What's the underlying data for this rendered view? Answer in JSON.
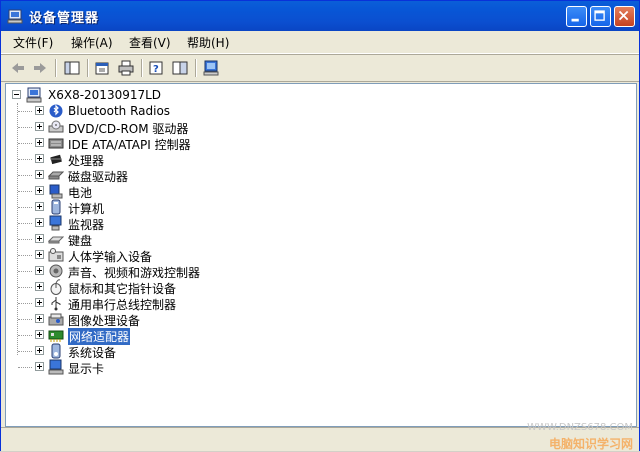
{
  "window": {
    "title": "设备管理器"
  },
  "menu": [
    {
      "label": "文件(F)"
    },
    {
      "label": "操作(A)"
    },
    {
      "label": "查看(V)"
    },
    {
      "label": "帮助(H)"
    }
  ],
  "toolbar": {
    "items": [
      "back-icon",
      "forward-icon",
      "show-tree-icon",
      "properties-icon",
      "print-icon",
      "help-icon",
      "device-view-icon",
      "scan-hardware-icon"
    ]
  },
  "tree": {
    "root": "X6X8-20130917LD",
    "items": [
      {
        "label": "Bluetooth Radios",
        "icon": "bluetooth-icon"
      },
      {
        "label": "DVD/CD-ROM 驱动器",
        "icon": "dvd-drive-icon"
      },
      {
        "label": "IDE ATA/ATAPI 控制器",
        "icon": "ide-controller-icon"
      },
      {
        "label": "处理器",
        "icon": "processor-icon"
      },
      {
        "label": "磁盘驱动器",
        "icon": "disk-drive-icon"
      },
      {
        "label": "电池",
        "icon": "battery-icon"
      },
      {
        "label": "计算机",
        "icon": "computer-icon"
      },
      {
        "label": "监视器",
        "icon": "monitor-icon"
      },
      {
        "label": "键盘",
        "icon": "keyboard-icon"
      },
      {
        "label": "人体学输入设备",
        "icon": "hid-icon"
      },
      {
        "label": "声音、视频和游戏控制器",
        "icon": "sound-icon"
      },
      {
        "label": "鼠标和其它指针设备",
        "icon": "mouse-icon"
      },
      {
        "label": "通用串行总线控制器",
        "icon": "usb-icon"
      },
      {
        "label": "图像处理设备",
        "icon": "imaging-icon"
      },
      {
        "label": "网络适配器",
        "icon": "network-adapter-icon",
        "selected": true
      },
      {
        "label": "系统设备",
        "icon": "system-device-icon"
      },
      {
        "label": "显示卡",
        "icon": "display-adapter-icon"
      }
    ]
  },
  "watermark": {
    "url": "WWW.DNZS678.COM",
    "site": "电脑知识学习网"
  }
}
